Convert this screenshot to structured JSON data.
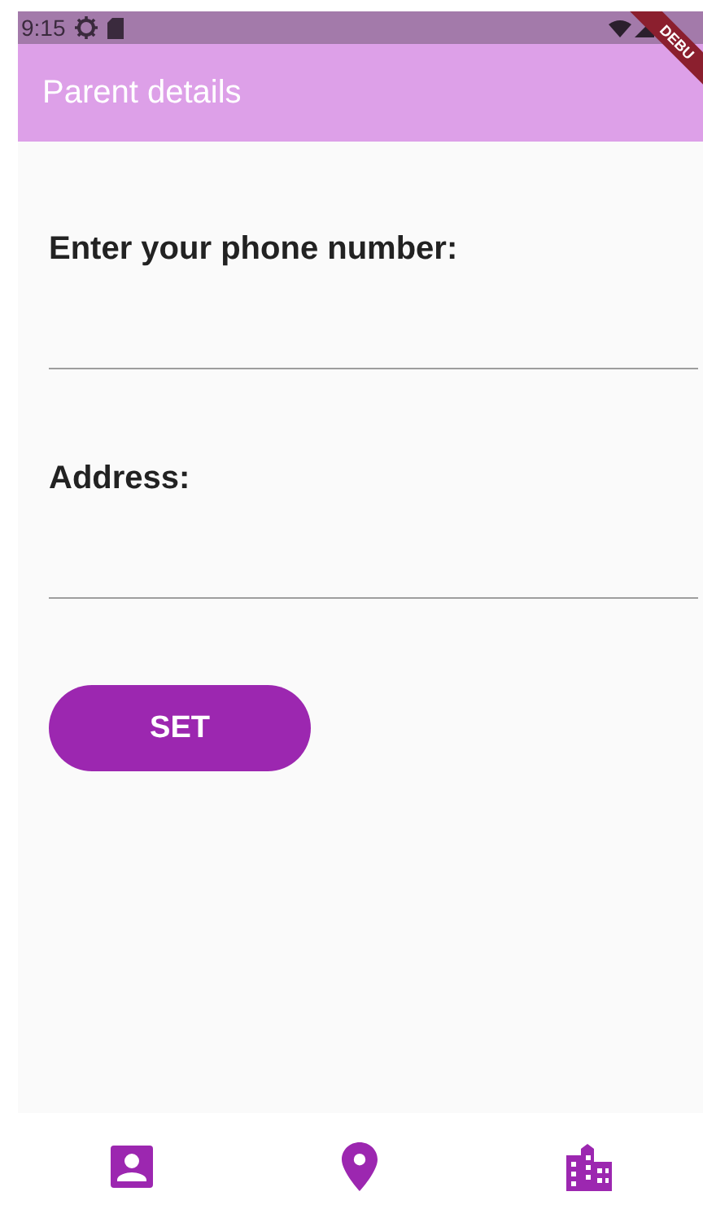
{
  "status_bar": {
    "time": "9:15"
  },
  "debug_banner": {
    "label": "DEBU"
  },
  "app_bar": {
    "title": "Parent details"
  },
  "fields": [
    {
      "label": "Enter your phone number:"
    },
    {
      "label": "Address:"
    }
  ],
  "button": {
    "label": "SET"
  },
  "bottom_nav": [
    {
      "kind": "contact"
    },
    {
      "kind": "place"
    },
    {
      "kind": "building"
    }
  ]
}
